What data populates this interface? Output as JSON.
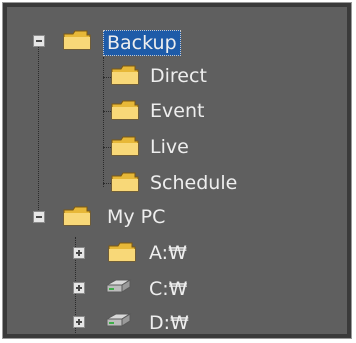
{
  "tree": {
    "backup": {
      "label": "Backup",
      "selected": true,
      "expanded": true,
      "children": [
        {
          "label": "Direct"
        },
        {
          "label": "Event"
        },
        {
          "label": "Live"
        },
        {
          "label": "Schedule"
        }
      ]
    },
    "mypc": {
      "label": "My PC",
      "expanded": true,
      "children": [
        {
          "label": "A:₩",
          "type": "folder"
        },
        {
          "label": "C:₩",
          "type": "drive"
        },
        {
          "label": "D:₩",
          "type": "drive"
        }
      ]
    }
  },
  "colors": {
    "panel_bg": "#5f5f5f",
    "selection": "#1e5ba8",
    "text": "#eeeeee",
    "folder": "#f2c94c"
  },
  "icons": {
    "folder": "folder-icon",
    "drive": "drive-icon",
    "collapse": "minus-box-icon",
    "expand": "plus-box-icon"
  }
}
